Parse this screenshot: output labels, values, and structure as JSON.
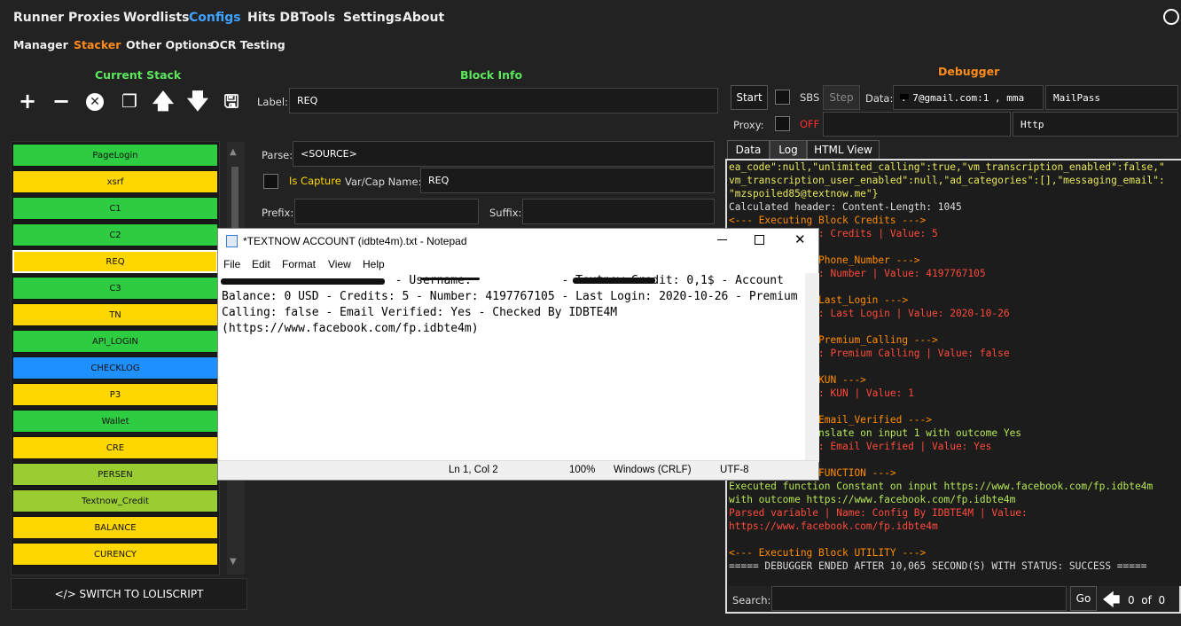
{
  "topnav": [
    "Runner",
    "Proxies",
    "Wordlists",
    "Configs",
    "Hits DB",
    "Tools",
    "Settings",
    "About"
  ],
  "subnav": [
    "Manager",
    "Stacker",
    "Other Options",
    "OCR Testing"
  ],
  "sections": {
    "current_stack": "Current Stack",
    "block_info": "Block Info",
    "debugger": "Debugger"
  },
  "colors": {
    "accent": "#3ea2ff",
    "orange": "#ff8c1a",
    "green_header": "#5ce65c",
    "yellow_header": "#e8d83a"
  },
  "block_info": {
    "label_label": "Label:",
    "label_value": "REQ",
    "parse_label": "Parse:",
    "parse_value": "<SOURCE>",
    "is_capture": "Is Capture",
    "varcap_label": "Var/Cap Name:",
    "varcap_value": "REQ",
    "prefix_label": "Prefix:",
    "suffix_label": "Suffix:"
  },
  "stack": [
    {
      "name": "PageLogin",
      "color": "g"
    },
    {
      "name": "xsrf",
      "color": "y"
    },
    {
      "name": "C1",
      "color": "g"
    },
    {
      "name": "C2",
      "color": "g"
    },
    {
      "name": "REQ",
      "color": "y"
    },
    {
      "name": "C3",
      "color": "g"
    },
    {
      "name": "TN",
      "color": "y"
    },
    {
      "name": "API_LOGIN",
      "color": "g"
    },
    {
      "name": "CHECKLOG",
      "color": "b"
    },
    {
      "name": "P3",
      "color": "y"
    },
    {
      "name": "Wallet",
      "color": "g"
    },
    {
      "name": "CRE",
      "color": "y"
    },
    {
      "name": "PERSEN",
      "color": "lg"
    },
    {
      "name": "Textnow_Credit",
      "color": "lg"
    },
    {
      "name": "BALANCE",
      "color": "y"
    },
    {
      "name": "CURENCY",
      "color": "y"
    }
  ],
  "switch_label": "</> SWITCH TO LOLISCRIPT",
  "debugger": {
    "start": "Start",
    "sbs": "SBS",
    "step": "Step",
    "data_label": "Data:",
    "data_value": "  .   7@gmail.com:1   ,  mma",
    "wordlist_type": "MailPass",
    "proxy_label": "Proxy:",
    "proxy_state": "OFF",
    "proxy_type": "Http",
    "tabs": [
      "Data",
      "Log",
      "HTML View"
    ],
    "search_label": "Search:",
    "go": "Go",
    "counter": "0  of  0"
  },
  "log_lines": [
    {
      "t": "ea_code\":null,\"unlimited_calling\":true,\"vm_transcription_enabled\":false,\"",
      "c": "c-y"
    },
    {
      "t": "vm_transcription_user_enabled\":null,\"ad_categories\":[],\"messaging_email\":",
      "c": "c-y"
    },
    {
      "t": "\"mzspoiled85@textnow.me\"}",
      "c": "c-y"
    },
    {
      "t": "Calculated header: Content-Length: 1045",
      "c": "c-w"
    },
    {
      "t": "<--- Executing Block Credits --->",
      "c": "c-o"
    },
    {
      "t": "         | Name: Credits | Value: 5",
      "c": "c-r"
    },
    {
      "t": "",
      "c": "c-w"
    },
    {
      "t": "         Block Phone_Number --->",
      "c": "c-o"
    },
    {
      "t": "         | Name: Number | Value: 4197767105",
      "c": "c-r"
    },
    {
      "t": "",
      "c": "c-w"
    },
    {
      "t": "         Block Last_Login --->",
      "c": "c-o"
    },
    {
      "t": "         | Name: Last Login | Value: 2020-10-26",
      "c": "c-r"
    },
    {
      "t": "",
      "c": "c-w"
    },
    {
      "t": "         Block Premium_Calling --->",
      "c": "c-o"
    },
    {
      "t": "         | Name: Premium Calling | Value: false",
      "c": "c-r"
    },
    {
      "t": "",
      "c": "c-w"
    },
    {
      "t": "         Block KUN --->",
      "c": "c-o"
    },
    {
      "t": "         | Name: KUN | Value: 1",
      "c": "c-r"
    },
    {
      "t": "",
      "c": "c-w"
    },
    {
      "t": "         Block Email_Verified --->",
      "c": "c-o"
    },
    {
      "t": "         on Translate on input 1 with outcome Yes",
      "c": "c-gy"
    },
    {
      "t": "         | Name: Email Verified | Value: Yes",
      "c": "c-r"
    },
    {
      "t": "",
      "c": "c-w"
    },
    {
      "t": "         Block FUNCTION --->",
      "c": "c-o"
    },
    {
      "t": "Executed function Constant on input https://www.facebook.com/fp.idbte4m",
      "c": "c-gy"
    },
    {
      "t": "with outcome https://www.facebook.com/fp.idbte4m",
      "c": "c-gy"
    },
    {
      "t": "Parsed variable | Name: Config By IDBTE4M | Value:",
      "c": "c-r"
    },
    {
      "t": "https://www.facebook.com/fp.idbte4m",
      "c": "c-r"
    },
    {
      "t": "",
      "c": "c-w"
    },
    {
      "t": "<--- Executing Block UTILITY --->",
      "c": "c-o"
    },
    {
      "t": "===== DEBUGGER ENDED AFTER 10,065 SECOND(S) WITH STATUS: SUCCESS =====",
      "c": "c-w"
    }
  ],
  "notepad": {
    "title": "*TEXTNOW ACCOUNT (idbte4m).txt - Notepad",
    "menu": [
      "File",
      "Edit",
      "Format",
      "View",
      "Help"
    ],
    "text": "                         - Username:             - Textnow Credit: 0,1$ - Account Balance: 0 USD - Credits: 5 - Number: 4197767105 - Last Login: 2020-10-26 - Premium Calling: false - Email Verified: Yes - Checked By IDBTE4M (https://www.facebook.com/fp.idbte4m)",
    "status": {
      "pos": "Ln 1, Col 2",
      "zoom": "100%",
      "eol": "Windows (CRLF)",
      "enc": "UTF-8"
    }
  }
}
